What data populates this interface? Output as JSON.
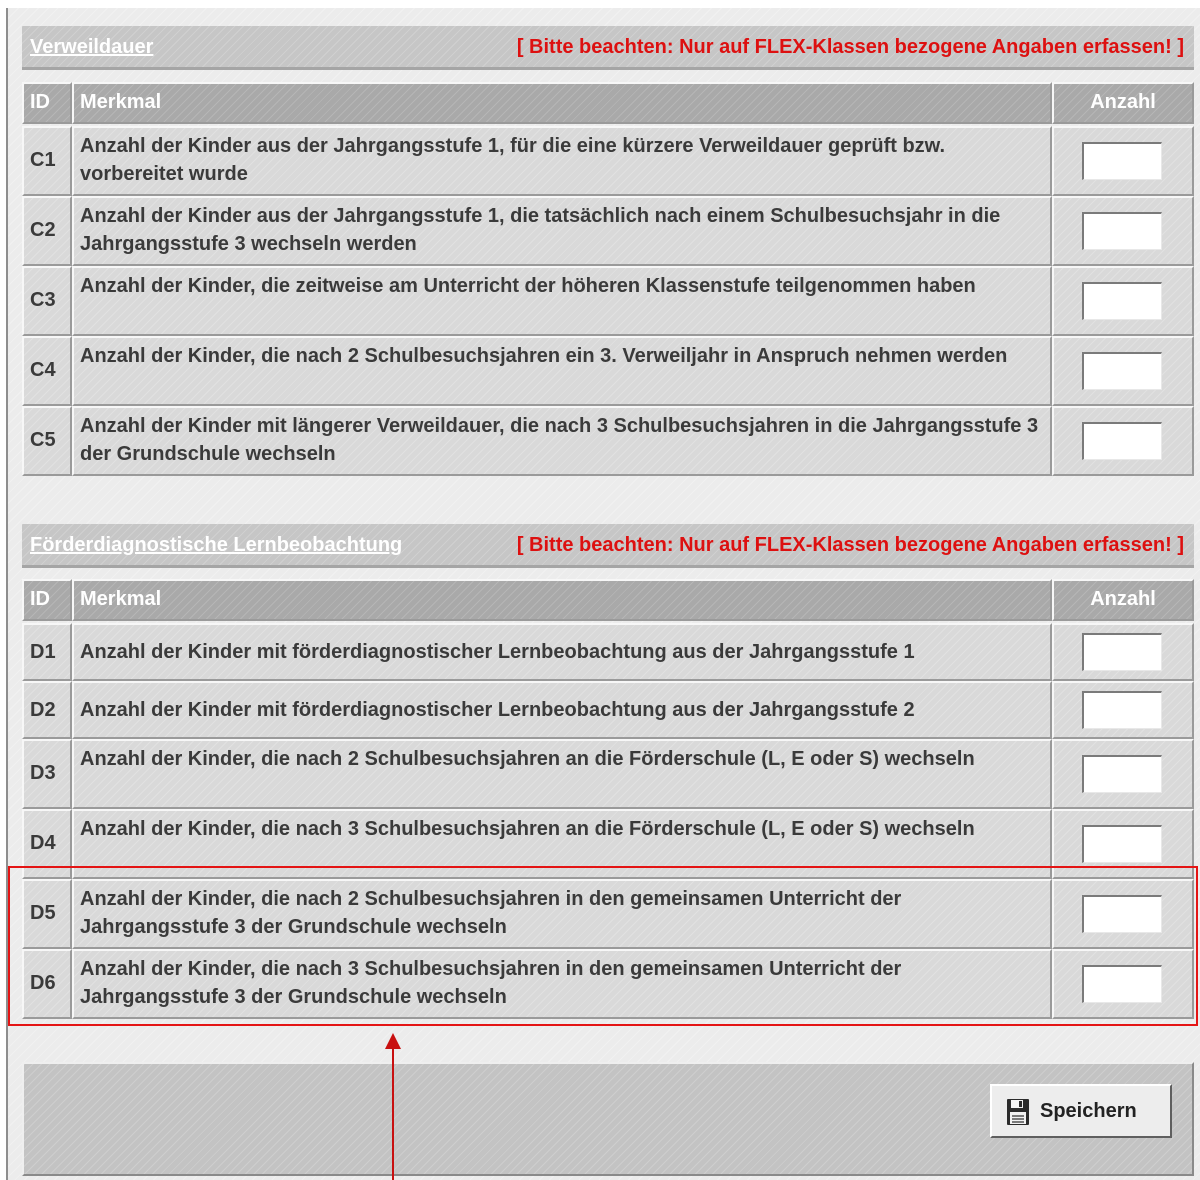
{
  "section_c": {
    "title": "Verweildauer",
    "note": "[ Bitte beachten: Nur auf FLEX-Klassen bezogene Angaben erfassen! ]",
    "headers": {
      "id": "ID",
      "merkmal": "Merkmal",
      "anzahl": "Anzahl"
    },
    "rows": [
      {
        "id": "C1",
        "label": "Anzahl der Kinder aus der Jahrgangsstufe 1, für die eine kürzere Verweildauer geprüft bzw. vorbereitet wurde",
        "value": ""
      },
      {
        "id": "C2",
        "label": "Anzahl der Kinder aus der Jahrgangsstufe 1, die tatsächlich nach einem Schulbesuchsjahr in die Jahrgangsstufe 3 wechseln werden",
        "value": ""
      },
      {
        "id": "C3",
        "label": "Anzahl der Kinder, die zeitweise am Unterricht der höheren Klassenstufe teilgenommen haben",
        "value": ""
      },
      {
        "id": "C4",
        "label": "Anzahl der Kinder, die nach 2 Schulbesuchsjahren ein 3. Verweiljahr in Anspruch nehmen werden",
        "value": ""
      },
      {
        "id": "C5",
        "label": "Anzahl der Kinder mit längerer Verweildauer, die nach 3 Schulbesuchsjahren in die Jahrgangsstufe 3 der Grundschule wechseln",
        "value": ""
      }
    ]
  },
  "section_d": {
    "title": "Förderdiagnostische Lernbeobachtung",
    "note": "[ Bitte beachten: Nur auf FLEX-Klassen bezogene Angaben erfassen! ]",
    "headers": {
      "id": "ID",
      "merkmal": "Merkmal",
      "anzahl": "Anzahl"
    },
    "rows": [
      {
        "id": "D1",
        "label": "Anzahl der Kinder mit förderdiagnostischer Lernbeobachtung aus der Jahrgangsstufe 1",
        "value": ""
      },
      {
        "id": "D2",
        "label": "Anzahl der Kinder mit förderdiagnostischer Lernbeobachtung aus der Jahrgangsstufe 2",
        "value": ""
      },
      {
        "id": "D3",
        "label": "Anzahl der Kinder, die nach 2 Schulbesuchsjahren an die Förderschule (L, E oder S) wechseln",
        "value": ""
      },
      {
        "id": "D4",
        "label": "Anzahl der Kinder, die nach 3 Schulbesuchsjahren an die Förderschule (L, E oder S) wechseln",
        "value": ""
      },
      {
        "id": "D5",
        "label": "Anzahl der Kinder, die nach 2 Schulbesuchsjahren in den gemeinsamen Unterricht der Jahrgangsstufe 3 der Grundschule wechseln",
        "value": ""
      },
      {
        "id": "D6",
        "label": "Anzahl der Kinder, die nach 3 Schulbesuchsjahren in den gemeinsamen Unterricht der Jahrgangsstufe 3 der Grundschule wechseln",
        "value": ""
      }
    ]
  },
  "footer": {
    "save_label": "Speichern",
    "save_icon": "floppy-disk-icon"
  },
  "colors": {
    "accent_note": "#dd1010",
    "annotation": "#e41414"
  }
}
